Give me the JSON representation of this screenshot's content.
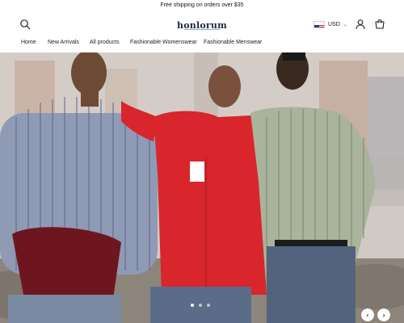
{
  "announcement": {
    "text": "Free shipping on orders over $35"
  },
  "header": {
    "logo": "honlorum",
    "currency": {
      "label": "USD"
    },
    "icons": {
      "search": "search-icon",
      "account": "user-icon",
      "cart": "cart-icon"
    }
  },
  "nav": {
    "items": [
      {
        "label": "Home"
      },
      {
        "label": "New Arrivals"
      },
      {
        "label": "All products"
      },
      {
        "label": "Fashionable Womenswear"
      },
      {
        "label": "Fashionable Menswear"
      }
    ]
  },
  "hero": {
    "slide_count": 3,
    "active_slide": 1
  },
  "colors": {
    "logo": "#1d2a44",
    "red_shirt": "#d8262c",
    "background": "#ffffff"
  }
}
